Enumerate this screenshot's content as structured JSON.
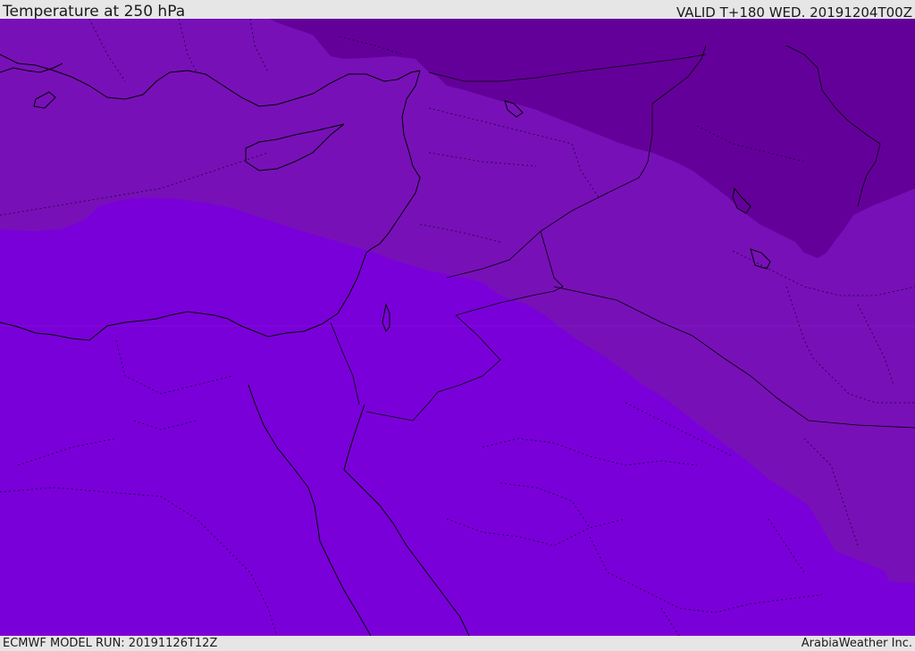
{
  "header": {
    "title": "Temperature at 250 hPa",
    "valid": "VALID T+180 WED. 20191204T00Z"
  },
  "footer": {
    "model_run": "ECMWF MODEL RUN: 20191126T12Z",
    "credit": "ArabiaWeather Inc."
  },
  "map": {
    "colors": {
      "band_warm": "#7a00d9",
      "band_mid": "#7810b8",
      "band_cold": "#64009a",
      "coastline": "#000000",
      "borders": "#1a0030"
    }
  }
}
